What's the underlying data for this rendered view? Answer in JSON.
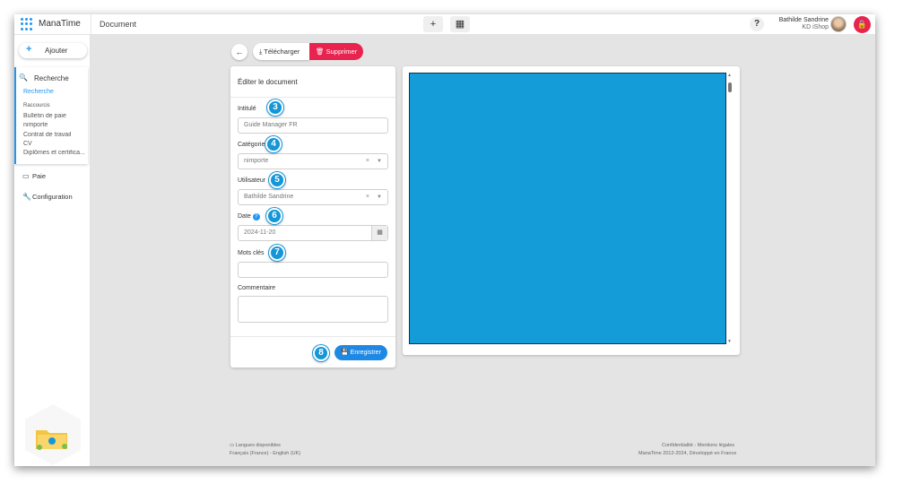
{
  "topbar": {
    "app_name": "ManaTime",
    "page_title": "Document",
    "add_label": "+",
    "user_name": "Bathilde Sandrine",
    "user_company": "KD iShop",
    "help_label": "?"
  },
  "sidebar": {
    "add_label": "Ajouter",
    "search_title": "Recherche",
    "search_active": "Recherche",
    "shortcuts_title": "Raccourcis",
    "shortcuts": [
      "Bulletin de paie",
      "nimporte",
      "Contrat de travail",
      "CV",
      "Diplômes et certifica..."
    ],
    "nav": [
      {
        "label": "Paie",
        "icon": "cash-register-icon"
      },
      {
        "label": "Configuration",
        "icon": "wrench-icon"
      }
    ]
  },
  "actions": {
    "download_label": "Télécharger",
    "delete_label": "Supprimer"
  },
  "form": {
    "title": "Éditer le document",
    "fields": {
      "title_label": "Intitulé",
      "title_value": "Guide Manager FR",
      "category_label": "Catégorie",
      "category_value": "nimporte",
      "user_label": "Utilisateur",
      "user_value": "Bathilde Sandrine",
      "date_label": "Date",
      "date_value": "2024-11-20",
      "keywords_label": "Mots clés",
      "keywords_value": "",
      "comment_label": "Commentaire",
      "comment_value": ""
    },
    "save_label": "Enregistrer"
  },
  "badges": {
    "b3": "3",
    "b4": "4",
    "b5": "5",
    "b6": "6",
    "b7": "7",
    "b8": "8"
  },
  "footer": {
    "lang_title": "Langues disponibles",
    "lang_list": "Français (France) - English (UK)",
    "legal": "Confidentialité - Mentions légales",
    "copyright": "ManaTime 2012-2024, Développé en France"
  },
  "colors": {
    "accent": "#2196f3",
    "danger": "#e8234f",
    "preview": "#139cd8",
    "badge": "#1596d8"
  }
}
